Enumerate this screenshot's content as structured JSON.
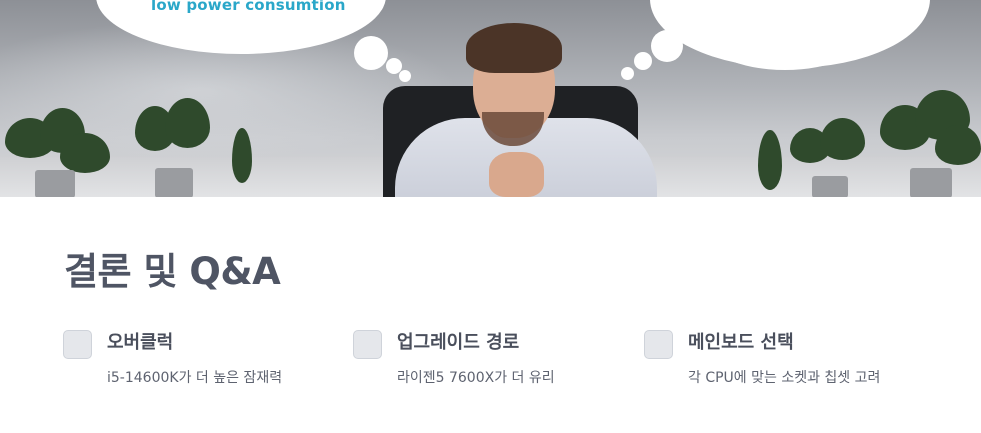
{
  "hero": {
    "thought_bubble_text": "low power consumtion"
  },
  "section": {
    "title": "결론 및 Q&A"
  },
  "items": [
    {
      "label": "오버클럭",
      "desc": "i5-14600K가 더 높은 잠재력"
    },
    {
      "label": "업그레이드 경로",
      "desc": "라이젠5 7600X가 더 유리"
    },
    {
      "label": "메인보드 선택",
      "desc": "각 CPU에 맞는 소켓과 칩셋 고려"
    }
  ]
}
